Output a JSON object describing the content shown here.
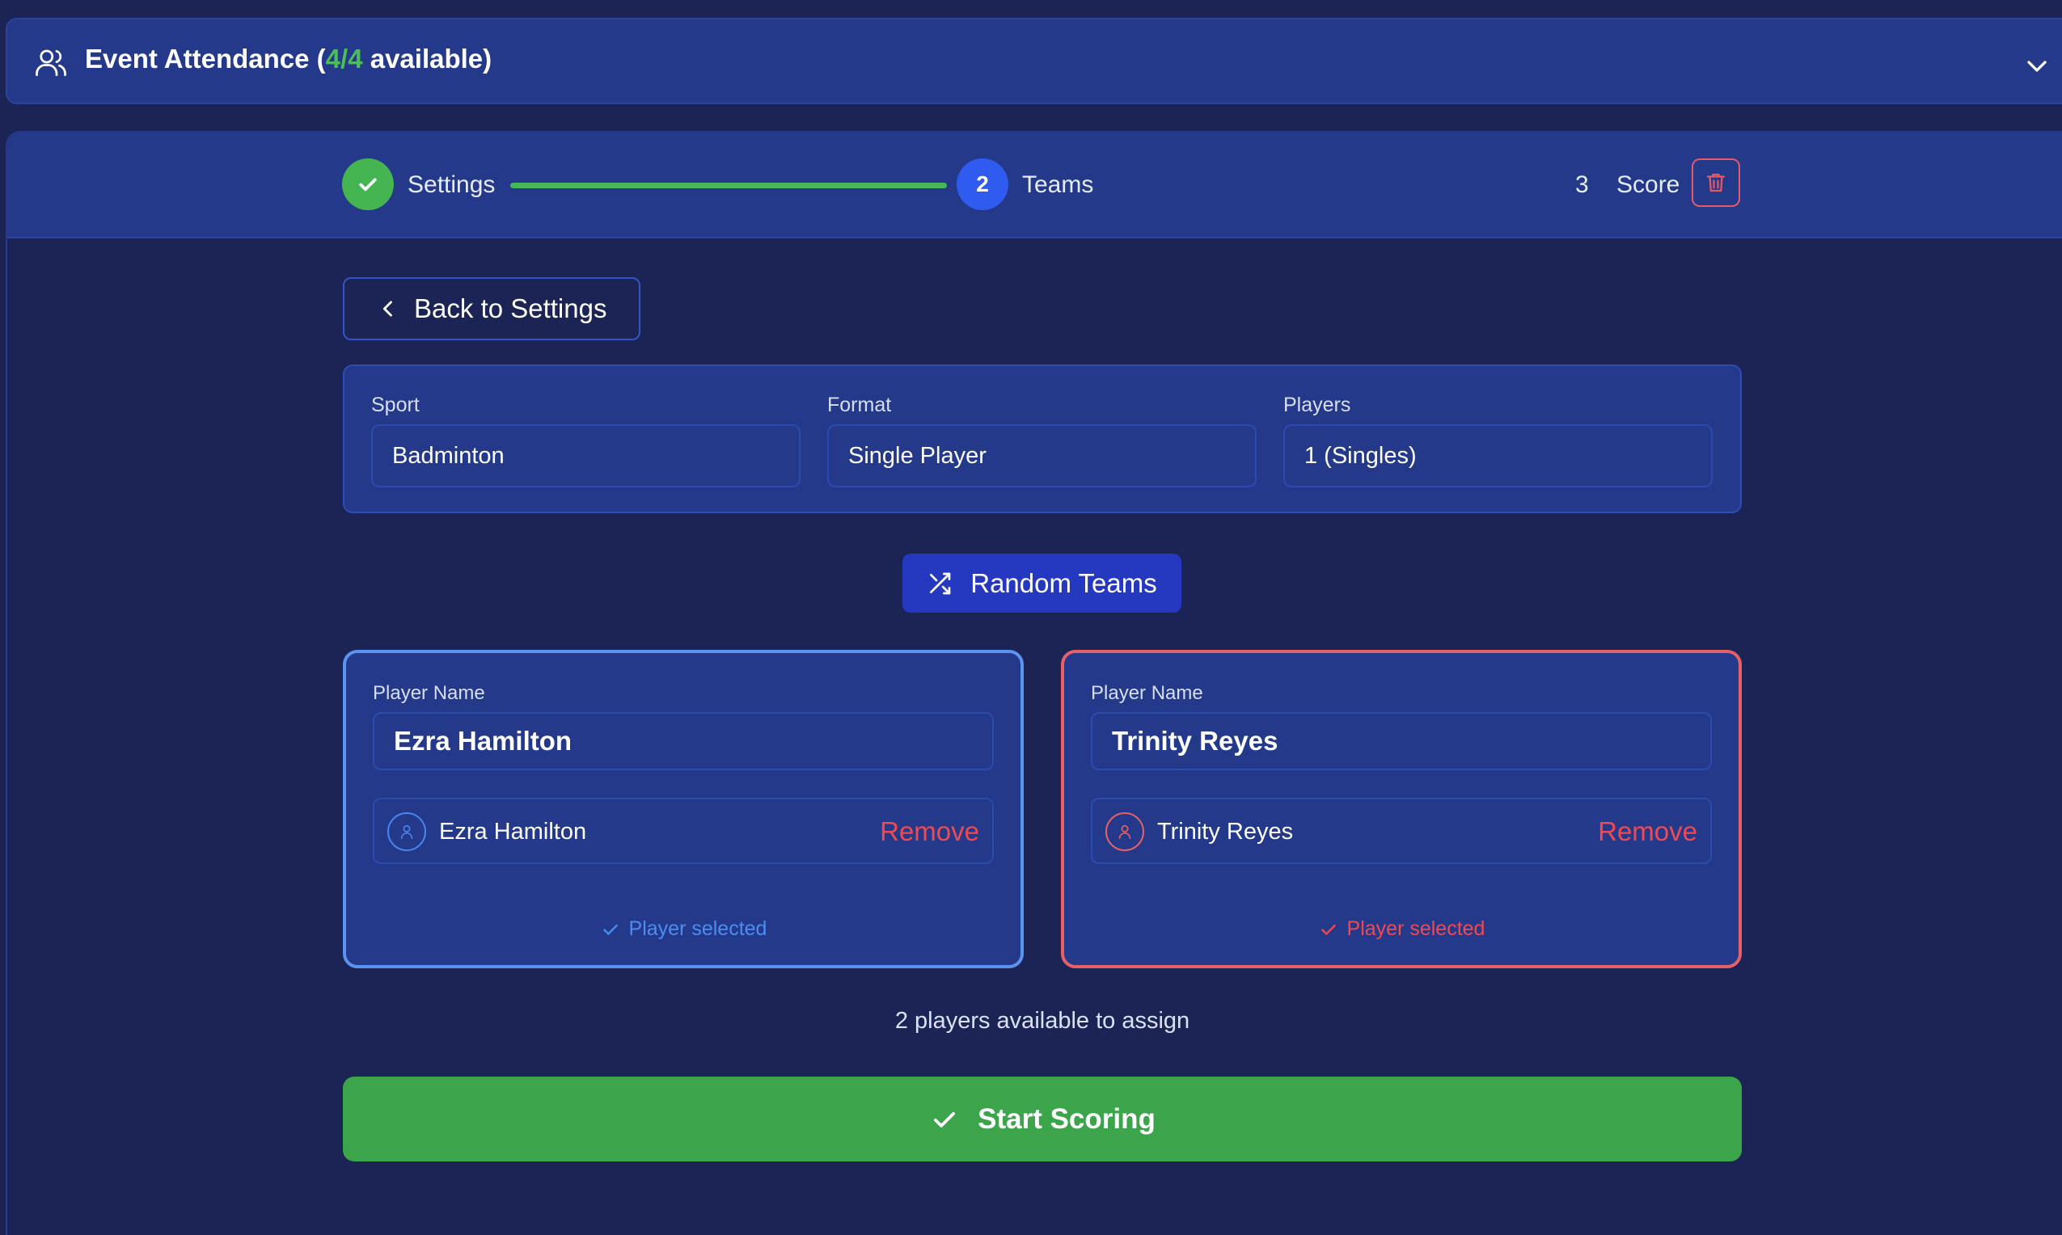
{
  "attendance": {
    "title_prefix": "Event Attendance (",
    "count": "4/4",
    "title_suffix": " available)"
  },
  "stepper": {
    "step1_label": "Settings",
    "step2_number": "2",
    "step2_label": "Teams",
    "step3_number": "3",
    "step3_label": "Score"
  },
  "back_button": {
    "label": "Back to Settings"
  },
  "settings": {
    "sport_label": "Sport",
    "sport_value": "Badminton",
    "format_label": "Format",
    "format_value": "Single Player",
    "players_label": "Players",
    "players_value": "1 (Singles)"
  },
  "random_button": {
    "label": "Random Teams"
  },
  "teams": [
    {
      "field_label": "Player Name",
      "input_value": "Ezra Hamilton",
      "player_name": "Ezra Hamilton",
      "remove_label": "Remove",
      "status": "Player selected",
      "color": "#5b93ef"
    },
    {
      "field_label": "Player Name",
      "input_value": "Trinity Reyes",
      "player_name": "Trinity Reyes",
      "remove_label": "Remove",
      "status": "Player selected",
      "color": "#e5616a"
    }
  ],
  "available_text": "2 players available to assign",
  "start_button": {
    "label": "Start Scoring"
  },
  "colors": {
    "background": "#1b2454",
    "panel": "#24398a",
    "success": "#3ca44b",
    "primary": "#2f5bf0",
    "danger": "#ef4a52"
  }
}
